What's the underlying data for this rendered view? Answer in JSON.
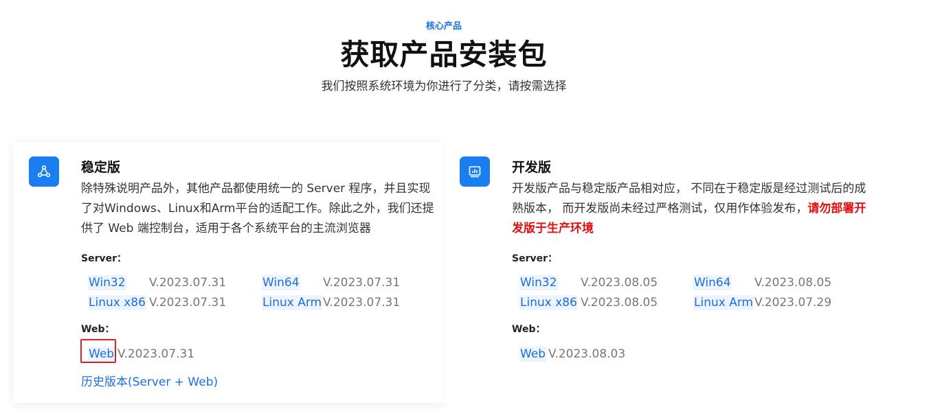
{
  "header": {
    "eyebrow": "核心产品",
    "title": "获取产品安装包",
    "subtitle": "我们按照系统环境为你进行了分类，请按需选择"
  },
  "stable": {
    "icon": "share-nodes-icon",
    "title": "稳定版",
    "description": "除特殊说明产品外，其他产品都使用统一的 Server 程序，并且实现了对Windows、Linux和Arm平台的适配工作。除此之外，我们还提供了 Web 端控制台，适用于各个系统平台的主流浏览器",
    "server_label": "Server：",
    "server": [
      {
        "name": "Win32",
        "version": "V.2023.07.31"
      },
      {
        "name": "Win64",
        "version": "V.2023.07.31"
      },
      {
        "name": "Linux x86",
        "version": "V.2023.07.31"
      },
      {
        "name": "Linux Arm",
        "version": "V.2023.07.31"
      }
    ],
    "web_label": "Web：",
    "web": {
      "name": "Web",
      "version": "V.2023.07.31"
    },
    "history": "历史版本(Server + Web)"
  },
  "dev": {
    "icon": "bar-chart-icon",
    "title": "开发版",
    "description": "开发版产品与稳定版产品相对应， 不同在于稳定版是经过测试后的成熟版本， 而开发版尚未经过严格测试，仅用作体验发布，",
    "warning": "请勿部署开发版于生产环境",
    "server_label": "Server：",
    "server": [
      {
        "name": "Win32",
        "version": "V.2023.08.05"
      },
      {
        "name": "Win64",
        "version": "V.2023.08.05"
      },
      {
        "name": "Linux x86",
        "version": "V.2023.08.05"
      },
      {
        "name": "Linux Arm",
        "version": "V.2023.07.29"
      }
    ],
    "web_label": "Web：",
    "web": {
      "name": "Web",
      "version": "V.2023.08.03"
    }
  },
  "colors": {
    "accent": "#1a6fe0",
    "icon_bg": "#1a7ef0",
    "warning": "#e01010",
    "highlight": "#e02020"
  }
}
